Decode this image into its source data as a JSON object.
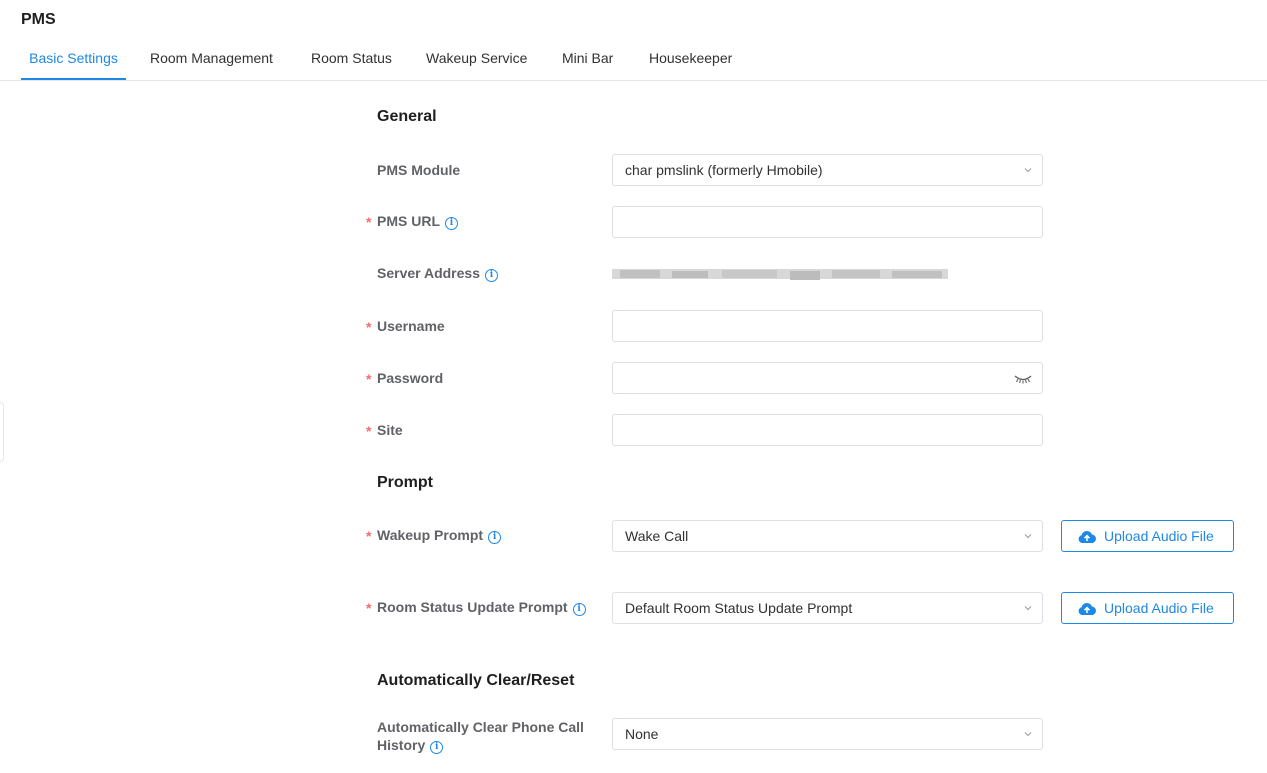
{
  "page": {
    "title": "PMS"
  },
  "tabs": [
    {
      "label": "Basic Settings",
      "active": true
    },
    {
      "label": "Room Management"
    },
    {
      "label": "Room Status"
    },
    {
      "label": "Wakeup Service"
    },
    {
      "label": "Mini Bar"
    },
    {
      "label": "Housekeeper"
    }
  ],
  "sections": {
    "general": "General",
    "prompt": "Prompt",
    "auto_clear": "Automatically Clear/Reset"
  },
  "fields": {
    "pms_module": {
      "label": "PMS Module",
      "value": "char pmslink (formerly Hmobile)"
    },
    "pms_url": {
      "label": "PMS URL",
      "value": ""
    },
    "server_address": {
      "label": "Server Address"
    },
    "username": {
      "label": "Username",
      "value": ""
    },
    "password": {
      "label": "Password",
      "value": ""
    },
    "site": {
      "label": "Site",
      "value": ""
    },
    "wakeup_prompt": {
      "label": "Wakeup Prompt",
      "value": "Wake Call"
    },
    "room_status_prompt": {
      "label": "Room Status Update Prompt",
      "value": "Default Room Status Update Prompt"
    },
    "auto_clear_history": {
      "label": "Automatically Clear Phone Call History",
      "value": "None"
    }
  },
  "buttons": {
    "upload_audio": "Upload Audio File"
  },
  "colors": {
    "accent": "#1e88e5",
    "required": "#f56c6c",
    "border": "#dcdfe6"
  }
}
